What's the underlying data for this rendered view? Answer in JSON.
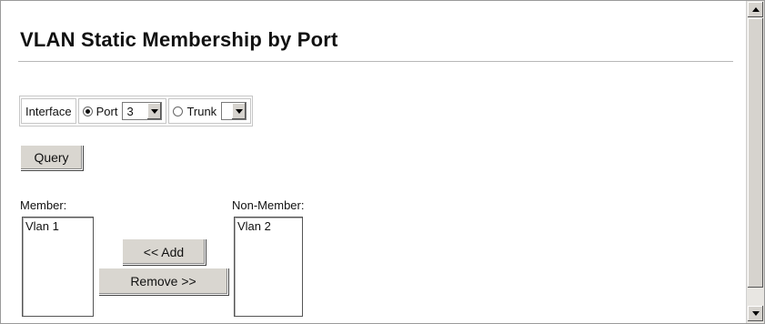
{
  "page": {
    "title": "VLAN Static Membership by Port"
  },
  "interface": {
    "label": "Interface",
    "port_option": "Port",
    "port_selected": true,
    "port_value": "3",
    "trunk_option": "Trunk",
    "trunk_selected": false,
    "trunk_value": ""
  },
  "buttons": {
    "query": "Query",
    "add": "<< Add",
    "remove": "Remove >>"
  },
  "member": {
    "label": "Member:",
    "items": [
      "Vlan 1"
    ]
  },
  "non_member": {
    "label": "Non-Member:",
    "items": [
      "Vlan 2"
    ]
  }
}
